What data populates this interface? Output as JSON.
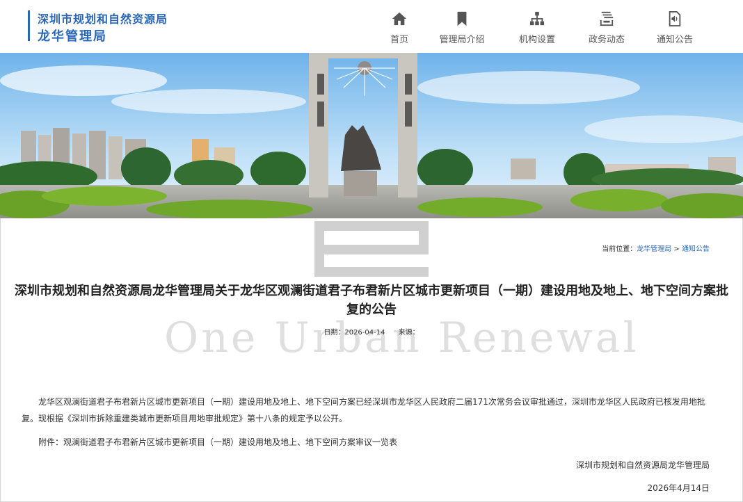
{
  "header": {
    "org_line1": "深圳市规划和自然资源局",
    "org_line2": "龙华管理局"
  },
  "nav": [
    {
      "label": "首页",
      "icon": "home-icon"
    },
    {
      "label": "管理局介绍",
      "icon": "bookmark-icon"
    },
    {
      "label": "机构设置",
      "icon": "org-chart-icon"
    },
    {
      "label": "政务动态",
      "icon": "news-icon"
    },
    {
      "label": "通知公告",
      "icon": "announcement-icon"
    }
  ],
  "breadcrumb": {
    "prefix": "当前位置：",
    "items": [
      "龙华管理局",
      "通知公告"
    ],
    "separator": " > "
  },
  "watermark": "One Urban Renewal",
  "article": {
    "title": "深圳市规划和自然资源局龙华管理局关于龙华区观澜街道君子布君新片区城市更新项目（一期）建设用地及地上、地下空间方案批复的公告",
    "date_label": "日期：",
    "date_value": "2026-04-14",
    "source_label": "来源：",
    "source_value": "",
    "paragraph1": "龙华区观澜街道君子布君新片区城市更新项目（一期）建设用地及地上、地下空间方案已经深圳市龙华区人民政府二届171次常务会议审批通过，深圳市龙华区人民政府已核发用地批复。现根据《深圳市拆除重建类城市更新项目用地审批规定》第十八条的规定予以公开。",
    "paragraph2": "附件：观澜街道君子布君新片区城市更新项目（一期）建设用地及地上、地下空间方案审议一览表",
    "signature": "深圳市规划和自然资源局龙华管理局",
    "sign_date": "2026年4月14日"
  },
  "colors": {
    "brand_blue": "#2a66b8"
  }
}
